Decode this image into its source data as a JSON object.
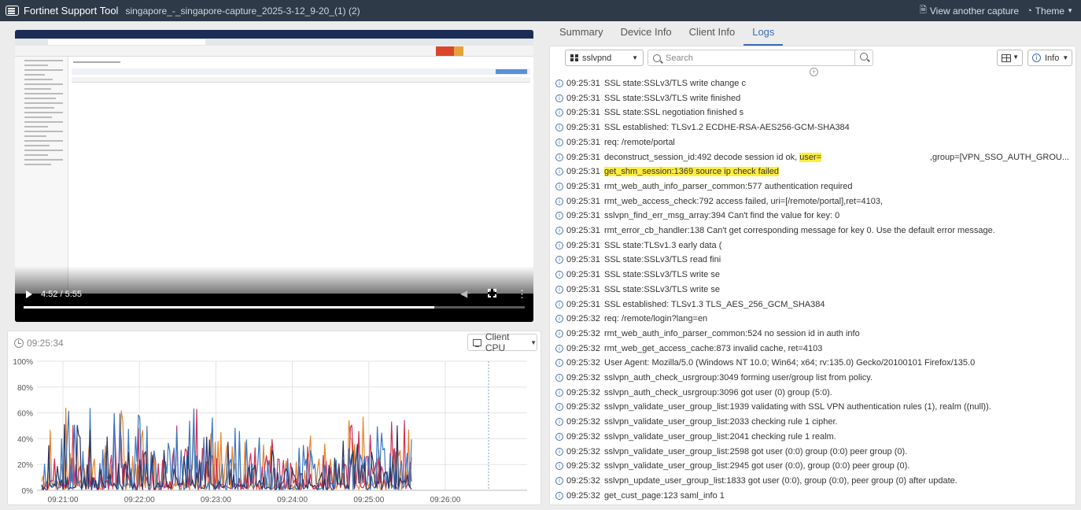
{
  "app": {
    "title": "Fortinet Support Tool",
    "capture_name": "singapore_-_singapore-capture_2025-3-12_9-20_(1) (2)",
    "view_another": "View another capture",
    "theme": "Theme"
  },
  "video": {
    "time": "4:52 / 5:55",
    "progress_fraction": 0.82
  },
  "cpu": {
    "timestamp": "09:25:34",
    "selector": "Client CPU"
  },
  "chart_data": {
    "type": "line",
    "y_ticks": [
      "100%",
      "80%",
      "60%",
      "40%",
      "20%",
      "0%"
    ],
    "x_ticks": [
      "09:21:00",
      "09:22:00",
      "09:23:00",
      "09:24:00",
      "09:25:00",
      "09:26:00"
    ],
    "ylim": [
      0,
      100
    ],
    "grid": true,
    "series_colors": [
      "#e8832a",
      "#d02f58",
      "#3a78c2",
      "#2d3460"
    ]
  },
  "tabs": [
    {
      "label": "Summary",
      "active": false
    },
    {
      "label": "Device Info",
      "active": false
    },
    {
      "label": "Client Info",
      "active": false
    },
    {
      "label": "Logs",
      "active": true
    }
  ],
  "logs_toolbar": {
    "process": "sslvpnd",
    "search_placeholder": "Search",
    "level": "Info",
    "add": "+"
  },
  "logs": [
    {
      "time": "09:25:31",
      "msg": "SSL state:SSLv3/TLS write change c",
      "hl": false
    },
    {
      "time": "09:25:31",
      "msg": "SSL state:SSLv3/TLS write finished",
      "hl": false
    },
    {
      "time": "09:25:31",
      "msg": "SSL state:SSL negotiation finished s",
      "hl": false
    },
    {
      "time": "09:25:31",
      "msg": "SSL established: TLSv1.2 ECDHE-RSA-AES256-GCM-SHA384",
      "hl": false
    },
    {
      "time": "09:25:31",
      "msg": "req: /remote/portal",
      "hl": false
    },
    {
      "time": "09:25:31",
      "msg": "deconstruct_session_id:492 decode session id ok, ",
      "hl_part": "user=",
      "msg2": ",group=[VPN_SSO_AUTH_GROU...",
      "hl": false
    },
    {
      "time": "09:25:31",
      "msg": "get_shm_session:1369 source ip check failed",
      "hl": true
    },
    {
      "time": "09:25:31",
      "msg": "rmt_web_auth_info_parser_common:577 authentication required",
      "hl": false
    },
    {
      "time": "09:25:31",
      "msg": "rmt_web_access_check:792 access failed, uri=[/remote/portal],ret=4103,",
      "hl": false
    },
    {
      "time": "09:25:31",
      "msg": "sslvpn_find_err_msg_array:394 Can't find the value for key: 0",
      "hl": false
    },
    {
      "time": "09:25:31",
      "msg": "rmt_error_cb_handler:138 Can't get corresponding message for key 0. Use the default error message.",
      "hl": false
    },
    {
      "time": "09:25:31",
      "msg": "SSL state:TLSv1.3 early data (",
      "hl": false
    },
    {
      "time": "09:25:31",
      "msg": "SSL state:SSLv3/TLS read fini",
      "hl": false
    },
    {
      "time": "09:25:31",
      "msg": "SSL state:SSLv3/TLS write se",
      "hl": false
    },
    {
      "time": "09:25:31",
      "msg": "SSL state:SSLv3/TLS write se",
      "hl": false
    },
    {
      "time": "09:25:31",
      "msg": "SSL established: TLSv1.3 TLS_AES_256_GCM_SHA384",
      "hl": false
    },
    {
      "time": "09:25:32",
      "msg": "req: /remote/login?lang=en",
      "hl": false
    },
    {
      "time": "09:25:32",
      "msg": "rmt_web_auth_info_parser_common:524 no session id in auth info",
      "hl": false
    },
    {
      "time": "09:25:32",
      "msg": "rmt_web_get_access_cache:873 invalid cache, ret=4103",
      "hl": false
    },
    {
      "time": "09:25:32",
      "msg": "User Agent: Mozilla/5.0 (Windows NT 10.0; Win64; x64; rv:135.0) Gecko/20100101 Firefox/135.0",
      "hl": false
    },
    {
      "time": "09:25:32",
      "msg": "sslvpn_auth_check_usrgroup:3049 forming user/group list from policy.",
      "hl": false
    },
    {
      "time": "09:25:32",
      "msg": "sslvpn_auth_check_usrgroup:3096 got user (0) group (5:0).",
      "hl": false
    },
    {
      "time": "09:25:32",
      "msg": "sslvpn_validate_user_group_list:1939 validating with SSL VPN authentication rules (1), realm ((null)).",
      "hl": false
    },
    {
      "time": "09:25:32",
      "msg": "sslvpn_validate_user_group_list:2033 checking rule 1 cipher.",
      "hl": false
    },
    {
      "time": "09:25:32",
      "msg": "sslvpn_validate_user_group_list:2041 checking rule 1 realm.",
      "hl": false
    },
    {
      "time": "09:25:32",
      "msg": "sslvpn_validate_user_group_list:2598 got user (0:0) group (0:0) peer group (0).",
      "hl": false
    },
    {
      "time": "09:25:32",
      "msg": "sslvpn_validate_user_group_list:2945 got user (0:0), group (0:0) peer group (0).",
      "hl": false
    },
    {
      "time": "09:25:32",
      "msg": "sslvpn_update_user_group_list:1833 got user (0:0), group (0:0), peer group (0) after update.",
      "hl": false
    },
    {
      "time": "09:25:32",
      "msg": "get_cust_page:123 saml_info 1",
      "hl": false
    }
  ],
  "icons": {
    "logo": "fortinet-logo-icon",
    "capture": "document-icon",
    "theme": "palette-icon",
    "info": "info-icon",
    "clock": "clock-icon",
    "monitor": "monitor-icon"
  }
}
